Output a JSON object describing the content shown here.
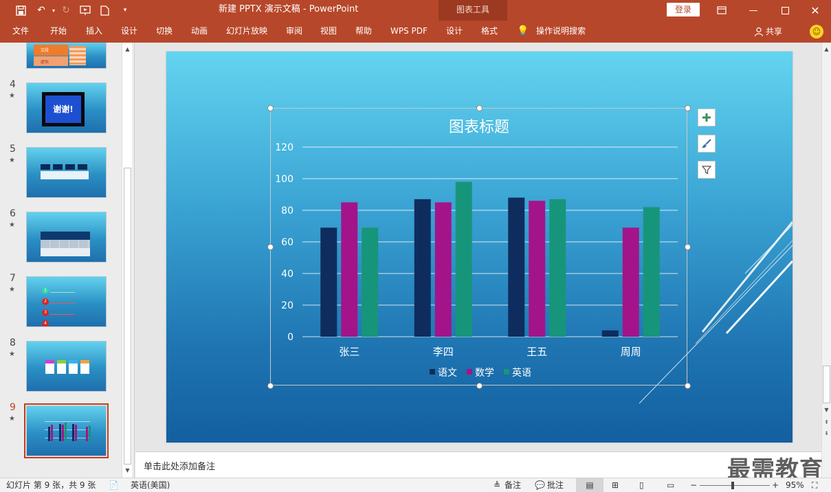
{
  "window": {
    "doc_title": "新建 PPTX 演示文稿  -  PowerPoint",
    "context_tool": "图表工具",
    "login_label": "登录"
  },
  "ribbon_tabs": [
    "文件",
    "开始",
    "插入",
    "设计",
    "切换",
    "动画",
    "幻灯片放映",
    "审阅",
    "视图",
    "帮助",
    "WPS PDF",
    "设计",
    "格式"
  ],
  "tell_me": "操作说明搜索",
  "share_label": "共享",
  "thumbnails": [
    {
      "num": "4",
      "text": "谢谢!"
    },
    {
      "num": "5"
    },
    {
      "num": "6"
    },
    {
      "num": "7",
      "items": [
        "1",
        "2",
        "3",
        "4"
      ]
    },
    {
      "num": "8"
    },
    {
      "num": "9",
      "active": true
    }
  ],
  "thumb_partial": {
    "labels": [
      "文段",
      "虚拟"
    ]
  },
  "chart_data": {
    "type": "bar",
    "title": "图表标题",
    "categories": [
      "张三",
      "李四",
      "王五",
      "周周"
    ],
    "series": [
      {
        "name": "语文",
        "values": [
          69,
          87,
          88,
          4
        ],
        "color": "#0e2d5e"
      },
      {
        "name": "数学",
        "values": [
          85,
          85,
          86,
          69
        ],
        "color": "#a3148a"
      },
      {
        "name": "英语",
        "values": [
          69,
          98,
          87,
          82
        ],
        "color": "#17957b"
      }
    ],
    "ylim": [
      0,
      120
    ],
    "yticks": [
      "0",
      "20",
      "40",
      "60",
      "80",
      "100",
      "120"
    ],
    "grid": true,
    "legend": "bottom"
  },
  "notes_placeholder": "单击此处添加备注",
  "status": {
    "slide_info": "幻灯片 第 9 张，共 9 张",
    "language": "英语(美国)",
    "notes_label": "备注",
    "comments_label": "批注",
    "zoom": "95%"
  },
  "watermark": "最需教育",
  "colors": {
    "accent": "#b7472a",
    "context_tab": "#9c3a21"
  }
}
